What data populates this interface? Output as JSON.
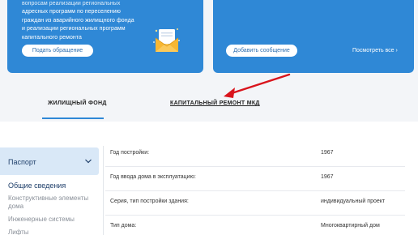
{
  "left_card": {
    "text_lines": [
      "вопросам реализации региональных",
      "адресных программ по переселению",
      "граждан из аварийного жилищного фонда",
      "и реализации региональных программ",
      "капитального ремонта"
    ],
    "button": "Подать обращение"
  },
  "right_card": {
    "button": "Добавить сообщение",
    "see_all": "Посмотреть все ›"
  },
  "tabs": {
    "housing": "ЖИЛИЩНЫЙ ФОНД",
    "capital": "КАПИТАЛЬНЫЙ РЕМОНТ МКД"
  },
  "sidebar": {
    "passport": "Паспорт",
    "items": [
      "Общие сведения",
      "Конструктивные элементы дома",
      "Инженерные системы",
      "Лифты"
    ]
  },
  "details": [
    {
      "label": "Год постройки:",
      "value": "1967"
    },
    {
      "label": "Год ввода дома в эксплуатацию:",
      "value": "1967"
    },
    {
      "label": "Серия, тип постройки здания:",
      "value": "индивидуальный проект"
    },
    {
      "label": "Тип дома:",
      "value": "Многоквартирный дом"
    }
  ],
  "colors": {
    "card_blue": "#2f88d6",
    "annotation_arrow": "#d9141c",
    "sidebar_active_bg": "#d9e8f7"
  },
  "icons": {
    "envelope": "envelope-icon",
    "chevron": "chevron-down-icon",
    "arrow": "annotation-arrow"
  }
}
